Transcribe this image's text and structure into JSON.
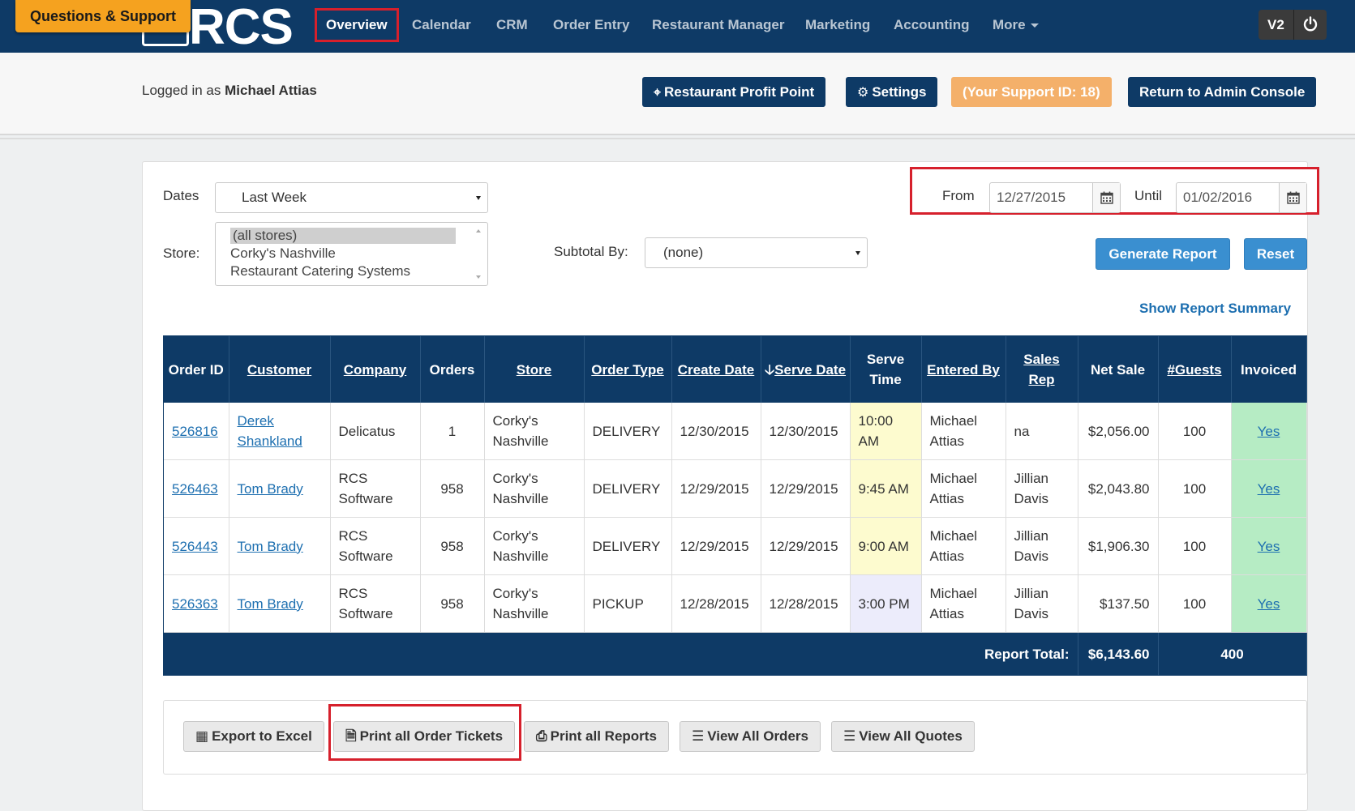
{
  "nav": {
    "support_tab": "Questions & Support",
    "logo_text": "RCS",
    "items": [
      "Overview",
      "Calendar",
      "CRM",
      "Order Entry",
      "Restaurant Manager",
      "Marketing",
      "Accounting",
      "More"
    ],
    "version_label": "V2"
  },
  "subheader": {
    "logged_in_prefix": "Logged in as",
    "user_name": "Michael Attias",
    "buttons": {
      "profit_point": "Restaurant Profit Point",
      "settings": "Settings",
      "support_id": "(Your Support ID: 18)",
      "admin_console": "Return to Admin Console"
    }
  },
  "filters": {
    "dates_label": "Dates",
    "dates_value": "Last Week",
    "store_label": "Store:",
    "store_options": [
      "(all stores)",
      "Corky's Nashville",
      "Restaurant Catering Systems"
    ],
    "subtotal_label": "Subtotal By:",
    "subtotal_value": "(none)",
    "from_label": "From",
    "from_value": "12/27/2015",
    "until_label": "Until",
    "until_value": "01/02/2016",
    "generate_label": "Generate Report",
    "reset_label": "Reset",
    "summary_link": "Show Report Summary"
  },
  "table": {
    "headers": {
      "order_id": "Order ID",
      "customer": "Customer",
      "company": "Company",
      "orders": "Orders",
      "store": "Store",
      "order_type": "Order Type",
      "create_date": "Create Date",
      "serve_date": "Serve Date",
      "serve_time": "Serve Time",
      "entered_by": "Entered By",
      "sales_rep": "Sales Rep",
      "net_sale": "Net Sale",
      "guests": "#Guests",
      "invoiced": "Invoiced"
    },
    "rows": [
      {
        "order_id": "526816",
        "customer": "Derek Shankland",
        "company": "Delicatus",
        "orders": "1",
        "store": "Corky's Nashville",
        "order_type": "DELIVERY",
        "create_date": "12/30/2015",
        "serve_date": "12/30/2015",
        "serve_time": "10:00 AM",
        "entered_by": "Michael Attias",
        "sales_rep": "na",
        "net_sale": "$2,056.00",
        "guests": "100",
        "invoiced": "Yes"
      },
      {
        "order_id": "526463",
        "customer": "Tom Brady",
        "company": "RCS Software",
        "orders": "958",
        "store": "Corky's Nashville",
        "order_type": "DELIVERY",
        "create_date": "12/29/2015",
        "serve_date": "12/29/2015",
        "serve_time": "9:45 AM",
        "entered_by": "Michael Attias",
        "sales_rep": "Jillian Davis",
        "net_sale": "$2,043.80",
        "guests": "100",
        "invoiced": "Yes"
      },
      {
        "order_id": "526443",
        "customer": "Tom Brady",
        "company": "RCS Software",
        "orders": "958",
        "store": "Corky's Nashville",
        "order_type": "DELIVERY",
        "create_date": "12/29/2015",
        "serve_date": "12/29/2015",
        "serve_time": "9:00 AM",
        "entered_by": "Michael Attias",
        "sales_rep": "Jillian Davis",
        "net_sale": "$1,906.30",
        "guests": "100",
        "invoiced": "Yes"
      },
      {
        "order_id": "526363",
        "customer": "Tom Brady",
        "company": "RCS Software",
        "orders": "958",
        "store": "Corky's Nashville",
        "order_type": "PICKUP",
        "create_date": "12/28/2015",
        "serve_date": "12/28/2015",
        "serve_time": "3:00 PM",
        "entered_by": "Michael Attias",
        "sales_rep": "Jillian Davis",
        "net_sale": "$137.50",
        "guests": "100",
        "invoiced": "Yes"
      }
    ],
    "total_label": "Report Total:",
    "total_net_sale": "$6,143.60",
    "total_guests": "400"
  },
  "actions": {
    "export_excel": "Export to Excel",
    "print_tickets": "Print all Order Tickets",
    "print_reports": "Print all Reports",
    "view_orders": "View All Orders",
    "view_quotes": "View All Quotes"
  },
  "colors": {
    "nav_bg": "#0e3a66",
    "accent_orange": "#f5a21f",
    "highlight_red": "#d6202c",
    "button_blue": "#3a8fd0",
    "invoiced_green": "#b6ecc4",
    "serve_time_yellow": "#fdfbcf"
  }
}
